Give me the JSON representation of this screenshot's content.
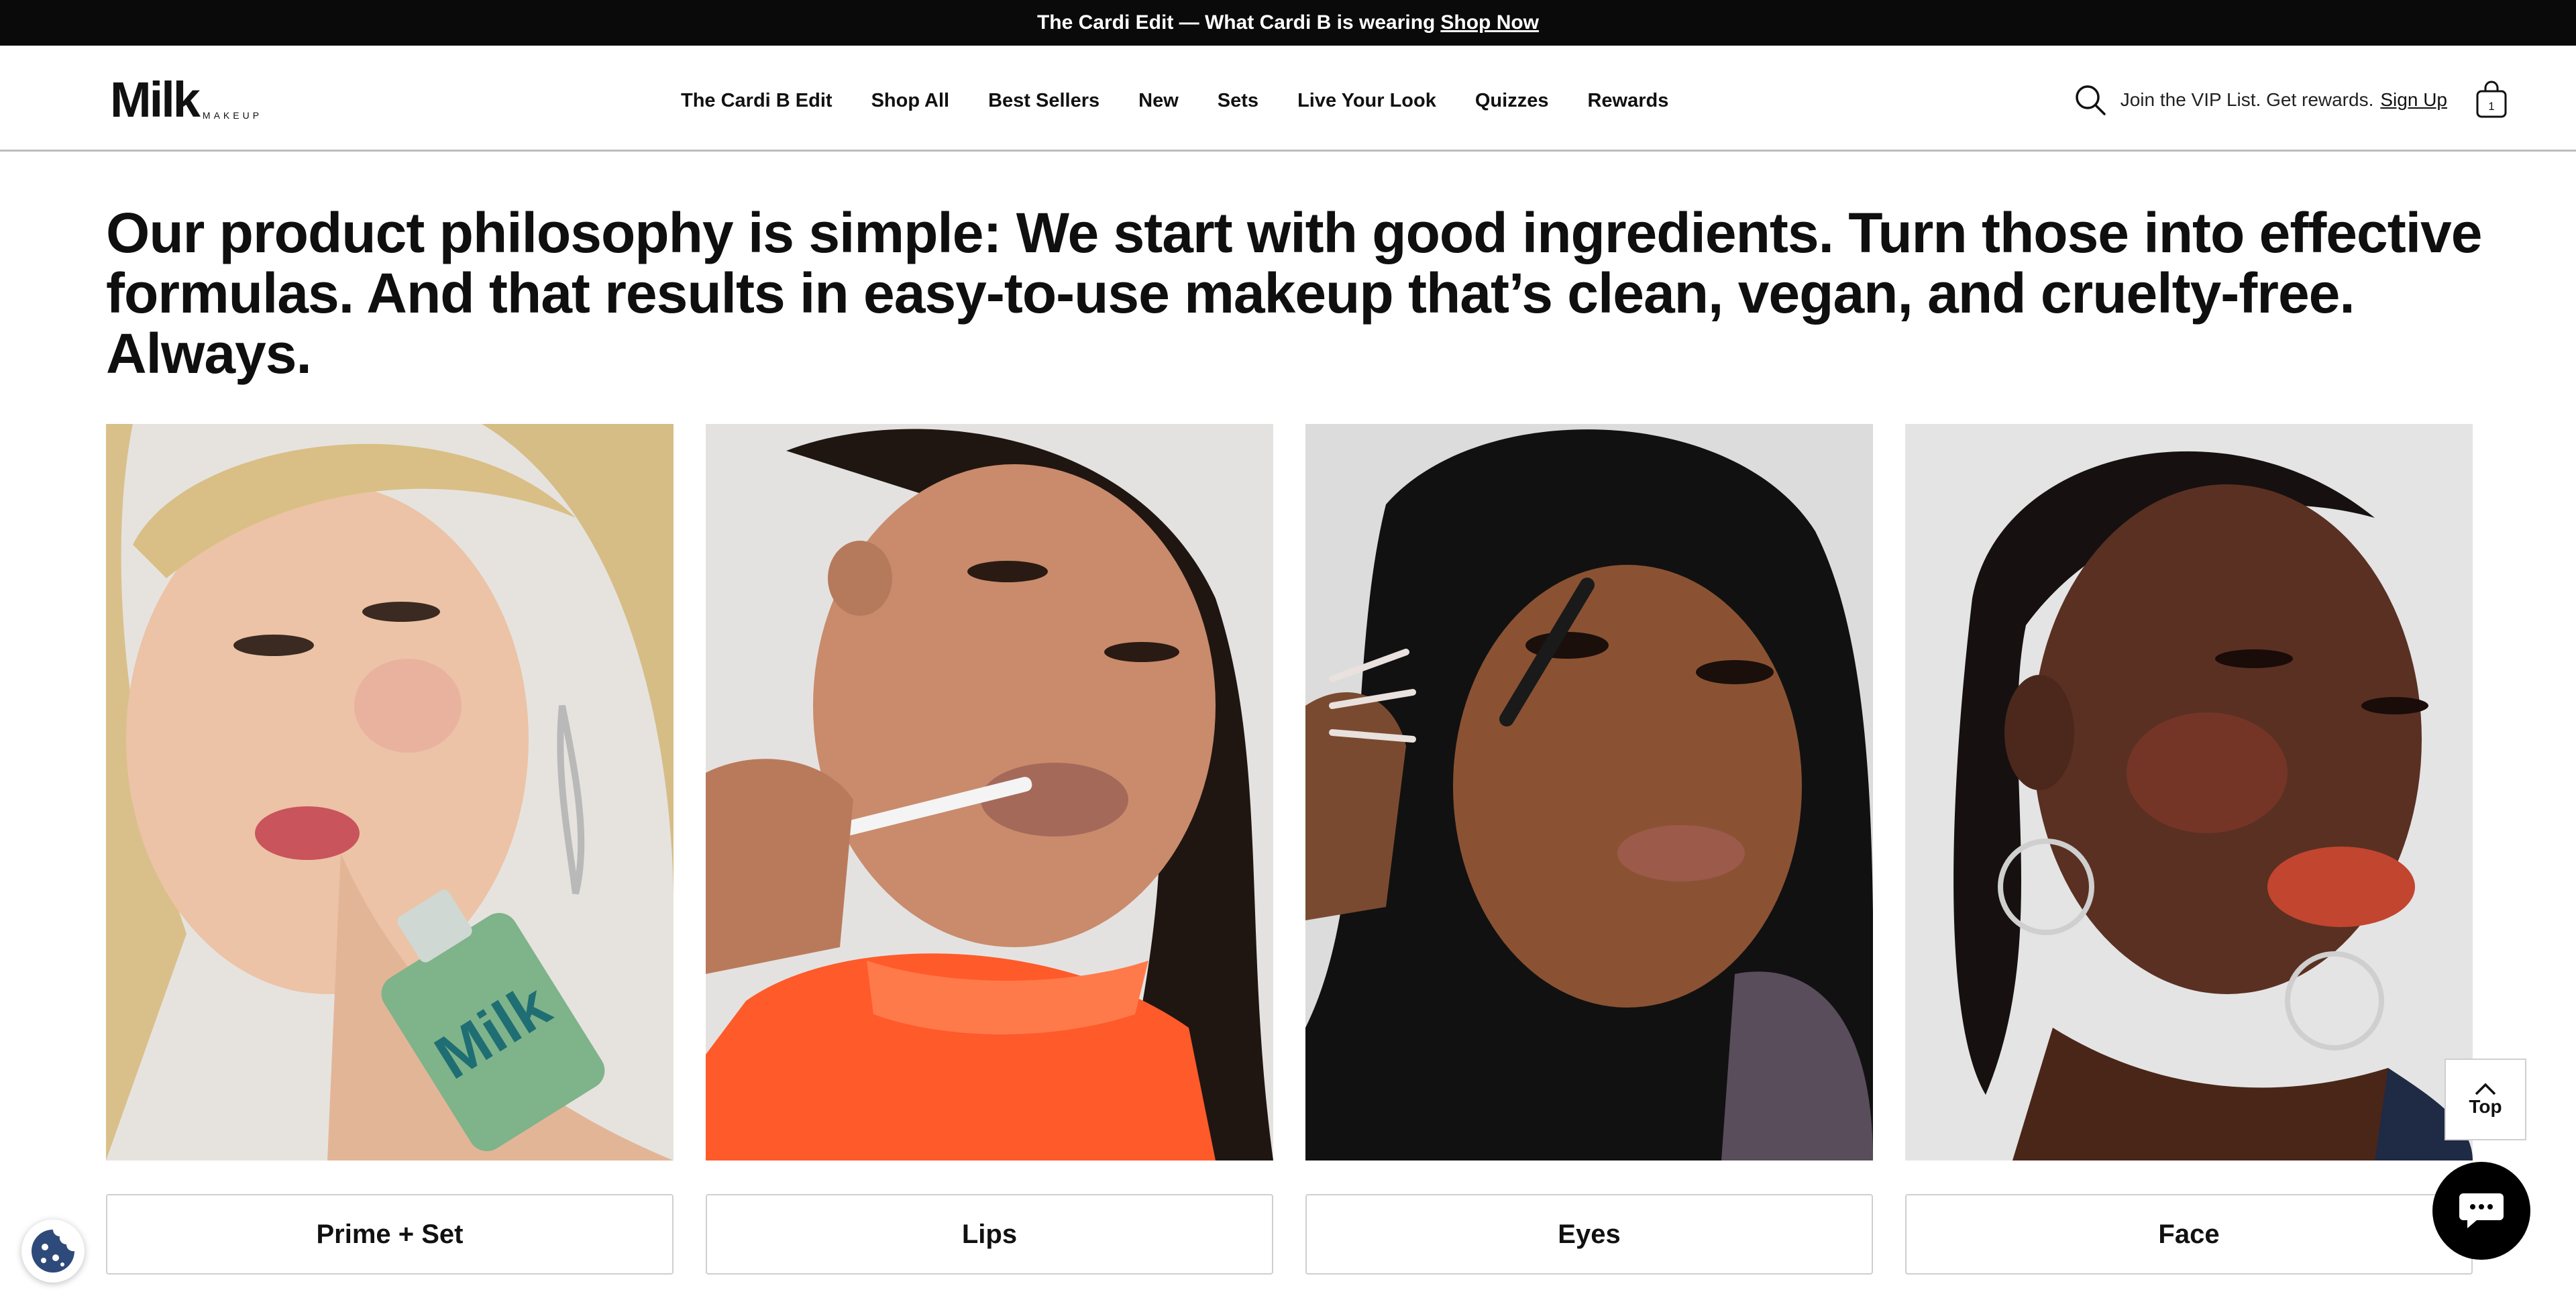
{
  "promo": {
    "text": "The Cardi Edit — What Cardi B is wearing",
    "link": "Shop Now"
  },
  "brand": {
    "name": "Milk",
    "sub": "MAKEUP"
  },
  "nav": {
    "items": [
      "The Cardi B Edit",
      "Shop All",
      "Best Sellers",
      "New",
      "Sets",
      "Live Your Look",
      "Quizzes",
      "Rewards"
    ]
  },
  "header": {
    "vip_text": "Join the VIP List. Get rewards.",
    "signup": "Sign Up",
    "cart_count": "1"
  },
  "headline": "Our product philosophy is simple: We start with good ingredients. Turn those into effective formulas. And that results in easy-to-use makeup that’s clean, vegan, and cruelty-free. Always.",
  "categories": [
    {
      "label": "Prime + Set"
    },
    {
      "label": "Lips"
    },
    {
      "label": "Eyes"
    },
    {
      "label": "Face"
    }
  ],
  "top_button": {
    "label": "Top"
  },
  "icons": {
    "search": "search-icon",
    "cart": "shopping-bag-icon",
    "chat": "chat-bubble-icon",
    "cookie": "cookie-icon",
    "top_arrow": "chevron-up-icon"
  }
}
